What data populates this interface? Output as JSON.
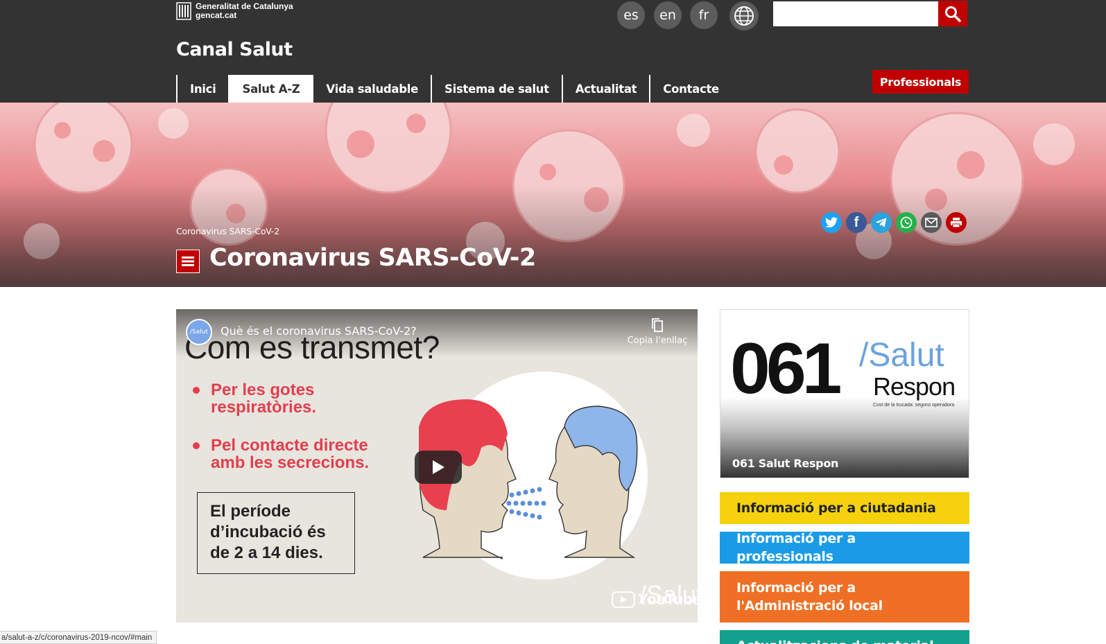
{
  "header": {
    "gencat_line1": "Generalitat de Catalunya",
    "gencat_line2": "gencat.cat",
    "languages": [
      "es",
      "en",
      "fr"
    ],
    "search_placeholder": "",
    "site_title": "Canal Salut",
    "nav": [
      "Inici",
      "Salut A-Z",
      "Vida saludable",
      "Sistema de salut",
      "Actualitat",
      "Contacte"
    ],
    "active_nav": "Salut A-Z",
    "professionals_label": "Professionals"
  },
  "hero": {
    "breadcrumb": "Coronavirus SARS-CoV-2",
    "title": "Coronavirus SARS-CoV-2",
    "share_icons": [
      "twitter-icon",
      "facebook-icon",
      "telegram-icon",
      "whatsapp-icon",
      "email-icon",
      "print-icon"
    ]
  },
  "video": {
    "channel": "/Salut",
    "title": "Què és el coronavirus SARS-CoV-2?",
    "copy_link": "Copia l'enllaç",
    "slide_heading": "Com es transmet?",
    "bullets": [
      [
        "Per les gotes",
        "respiratòries."
      ],
      [
        "Pel contacte directe",
        "amb les secrecions."
      ]
    ],
    "incubation": [
      "El període",
      "d’incubació és",
      "de 2 a 14 dies."
    ],
    "youtube": "YouTube",
    "watermark": "/Salut"
  },
  "sidebar": {
    "promo_number": "061",
    "promo_salut": "/Salut",
    "promo_respon": "Respon",
    "promo_note": "Cost de la trucada: segons operadora",
    "promo_caption": "061 Salut Respon",
    "buttons": [
      {
        "label": "Informació per a ciutadania",
        "bg": "#f6d20e",
        "fg": "#222222"
      },
      {
        "label": "Informació per a professionals",
        "bg": "#1a9be8",
        "fg": "#ffffff"
      },
      {
        "label": "Informació per a l'Administració local",
        "bg": "#ef7025",
        "fg": "#ffffff"
      },
      {
        "label": "Actualitzacions de material",
        "bg": "#13a08f",
        "fg": "#ffffff"
      }
    ]
  },
  "status_url": "a/salut-a-z/c/coronavirus-2019-ncov/#main",
  "colors": {
    "header_bg": "#333333",
    "brand_red": "#c00000",
    "accent_blue": "#6aa3de"
  }
}
